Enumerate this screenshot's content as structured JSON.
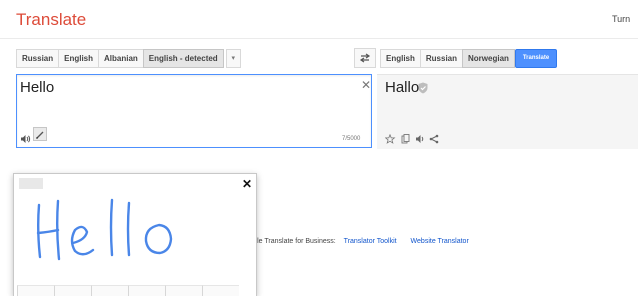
{
  "header": {
    "title": "Translate",
    "right_text": "Turn"
  },
  "source": {
    "languages": [
      "Russian",
      "English",
      "Albanian",
      "English - detected"
    ],
    "input_value": "Hello",
    "char_count": "7/5000",
    "icons": [
      "speaker-icon",
      "pencil-icon",
      "clear-icon"
    ]
  },
  "target": {
    "languages": [
      "English",
      "Russian",
      "Norwegian"
    ],
    "translate_button": "Translate",
    "output_text": "Hallo",
    "icons": [
      "verified-shield-icon",
      "star-icon",
      "copy-icon",
      "speaker-icon",
      "share-icon"
    ]
  },
  "page": {
    "partial_text": "Google Translate for Business:",
    "links": [
      "Translator Toolkit",
      "Website Translator"
    ]
  },
  "handwriting": {
    "drawn_word": "Hello",
    "ink_color": "#4a86e8"
  },
  "colors": {
    "brand": "#dd4b39",
    "accent": "#4d90fe",
    "link": "#1155cc"
  }
}
